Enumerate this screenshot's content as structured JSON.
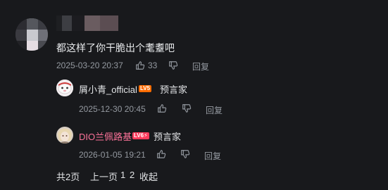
{
  "comment": {
    "text": "都这样了你干脆出个耄耋吧",
    "date": "2025-03-20 20:37",
    "likes": "33",
    "reply_label": "回复"
  },
  "replies": [
    {
      "username": "屑小青_official",
      "level": "LV5",
      "level_color": "#ff6c00",
      "name_color": "#e3e5e7",
      "tag": "预言家",
      "date": "2025-12-30 20:45",
      "reply_label": "回复"
    },
    {
      "username": "DIO兰佩路基",
      "level": "LV6⚡",
      "level_color": "#ff3b5c",
      "name_color": "#fb7299",
      "tag": "预言家",
      "date": "2026-01-05 19:21",
      "reply_label": "回复"
    }
  ],
  "pagination": {
    "total": "共2页",
    "prev": "上一页",
    "page1": "1",
    "page2": "2",
    "collapse": "收起"
  }
}
